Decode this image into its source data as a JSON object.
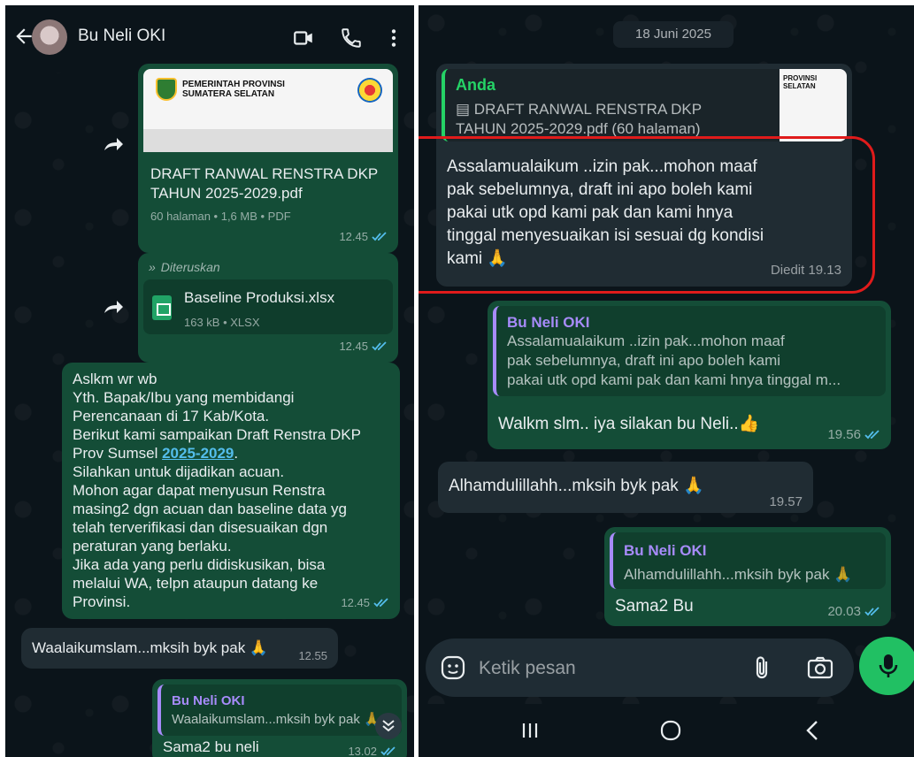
{
  "left": {
    "header": {
      "title": "Bu Neli OKI"
    },
    "pdf_message": {
      "thumb_header_line1": "PEMERINTAH PROVINSI",
      "thumb_header_line2": "SUMATERA SELATAN",
      "file_line1": "DRAFT RANWAL RENSTRA DKP",
      "file_line2": "TAHUN 2025-2029.pdf",
      "meta": "60 halaman • 1,6 MB • PDF",
      "time": "12.45"
    },
    "xlsx_message": {
      "forward_label": "Diteruskan",
      "file_name": "Baseline Produksi.xlsx",
      "meta": "163 kB • XLSX",
      "time": "12.45"
    },
    "announcement": {
      "text_part1": "Aslkm wr wb\nYth. Bapak/Ibu yang membidangi\nPerencanaan di 17 Kab/Kota.\nBerikut kami sampaikan Draft Renstra DKP\nProv Sumsel ",
      "link": "2025-2029",
      "text_part2": ".\nSilahkan untuk dijadikan acuan.\nMohon agar dapat menyusun Renstra\nmasing2 dgn acuan dan baseline data yg\ntelah terverifikasi dan disesuaikan dgn\nperaturan yang berlaku.\nJika ada yang perlu didiskusikan, bisa\nmelalui WA, telpn ataupun datang ke\nProvinsi.",
      "time": "12.45"
    },
    "reply_in": {
      "text": "Waalaikumslam...mksih byk pak 🙏",
      "time": "12.55"
    },
    "reply_out": {
      "quote_name": "Bu Neli OKI",
      "quote_text": "Waalaikumslam...mksih byk pak 🙏",
      "text": "Sama2 bu neli",
      "time": "13.02"
    }
  },
  "right": {
    "date": "18 Juni 2025",
    "msg1": {
      "quote_name": "Anda",
      "quote_line1": "DRAFT RANWAL RENSTRA DKP",
      "quote_line2": "TAHUN 2025-2029.pdf (60 halaman)",
      "thumb_header_line1": "PROVINSI",
      "thumb_header_line2": "SELATAN",
      "text": "Assalamualaikum ..izin pak...mohon maaf\npak sebelumnya,  draft ini apo boleh kami\npakai utk opd kami pak dan kami hnya\ntinggal menyesuaikan isi sesuai dg kondisi\nkami 🙏",
      "time": "Diedit 19.13"
    },
    "msg2": {
      "quote_name": "Bu Neli OKI",
      "quote_line1": "Assalamualaikum ..izin pak...mohon maaf",
      "quote_line2": "pak sebelumnya,  draft ini apo boleh kami",
      "quote_line3": "pakai utk opd kami pak dan kami hnya tinggal m...",
      "text": "Walkm slm.. iya silakan bu Neli..👍",
      "time": "19.56"
    },
    "msg3": {
      "text": "Alhamdulillahh...mksih byk pak 🙏",
      "time": "19.57"
    },
    "msg4": {
      "quote_name": "Bu Neli OKI",
      "quote_text": "Alhamdulillahh...mksih byk pak 🙏",
      "text": "Sama2 Bu",
      "time": "20.03"
    },
    "composer": {
      "placeholder": "Ketik pesan"
    }
  },
  "colors": {
    "outgoing": "#144d37",
    "incoming": "#202c33",
    "accent": "#21c063",
    "highlight": "#e01b1b"
  },
  "icons": [
    "back-arrow-icon",
    "video-call-icon",
    "phone-icon",
    "more-vert-icon",
    "forward-icon",
    "double-check-icon",
    "xlsx-icon",
    "sticker-icon",
    "attach-icon",
    "camera-icon",
    "mic-icon",
    "recents-icon",
    "home-icon",
    "back-icon",
    "scroll-down-icon"
  ]
}
